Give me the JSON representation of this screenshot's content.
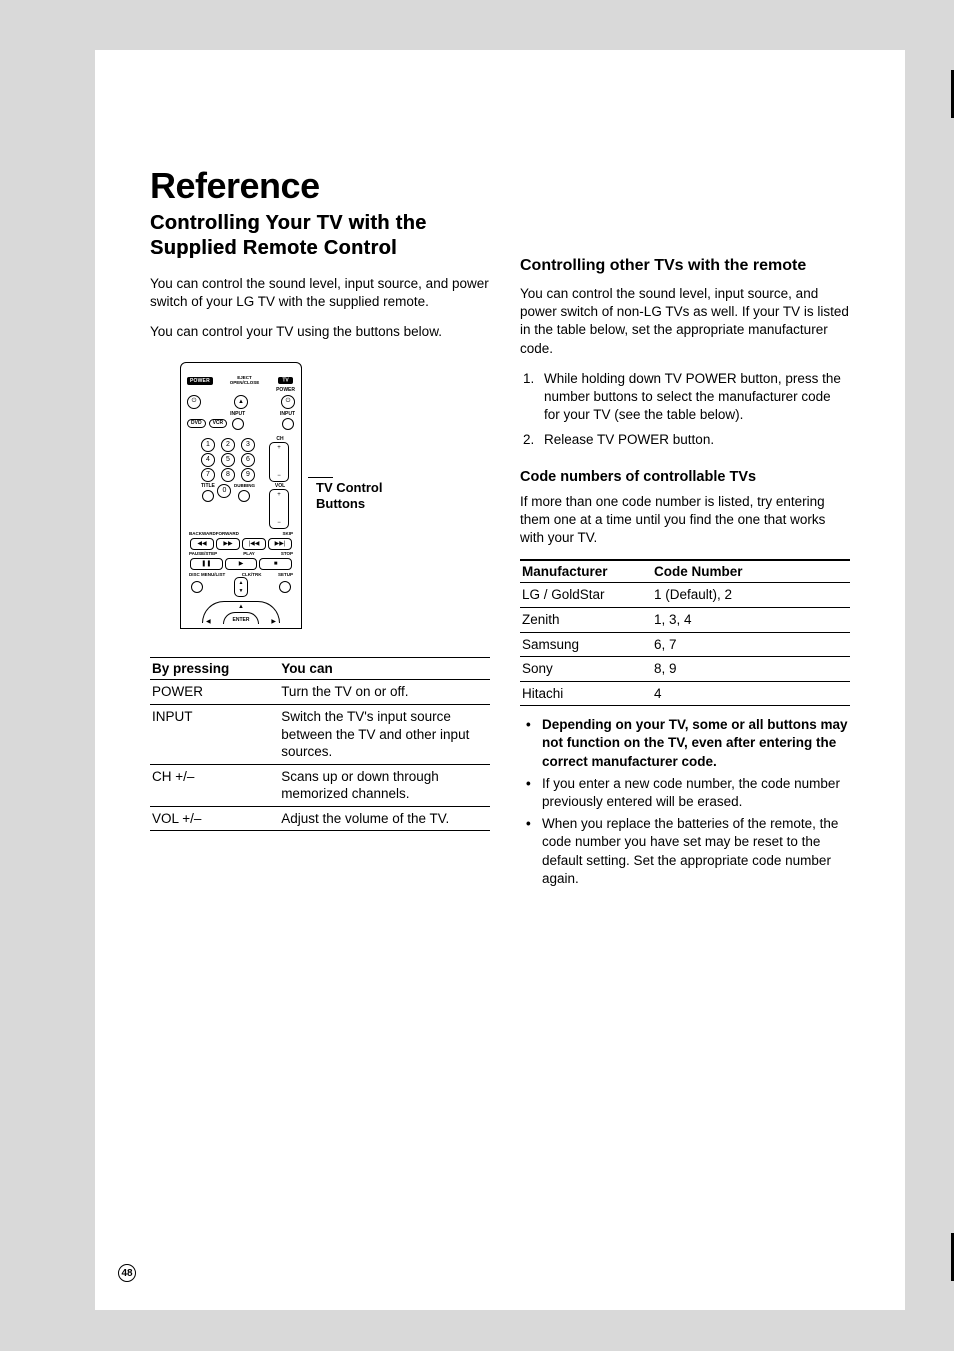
{
  "title": "Reference",
  "subtitle_l1": "Controlling Your TV with the",
  "subtitle_l2": "Supplied Remote Control",
  "left": {
    "p1": "You can control the sound level, input source, and power switch of your LG TV with the supplied remote.",
    "p2": "You can control your TV using the buttons below.",
    "tv_caption_l1": "TV Control",
    "tv_caption_l2": "Buttons"
  },
  "controls_table": {
    "h1": "By pressing",
    "h2": "You can",
    "rows": [
      {
        "a": "POWER",
        "b": "Turn the TV on or off."
      },
      {
        "a": "INPUT",
        "b": "Switch the TV's input source between the TV and other input sources."
      },
      {
        "a": "CH +/–",
        "b": "Scans up or down through memorized channels."
      },
      {
        "a": "VOL +/–",
        "b": "Adjust the volume of the TV."
      }
    ]
  },
  "right": {
    "h1": "Controlling other TVs with the remote",
    "p1": "You can control the sound level, input source, and power switch of non-LG TVs as well. If your TV is listed in the table below, set the appropriate manufacturer code.",
    "steps": [
      "While holding down TV POWER button, press the number buttons to select the manufacturer code for your TV (see the table below).",
      "Release TV POWER button."
    ],
    "h2": "Code numbers of controllable TVs",
    "p2": "If more than one code number is listed, try entering them one at a time until you find the one that works with your TV."
  },
  "codes_table": {
    "h1": "Manufacturer",
    "h2": "Code Number",
    "rows": [
      {
        "a": "LG / GoldStar",
        "b": "1 (Default), 2"
      },
      {
        "a": "Zenith",
        "b": "1, 3, 4"
      },
      {
        "a": "Samsung",
        "b": "6, 7"
      },
      {
        "a": "Sony",
        "b": "8, 9"
      },
      {
        "a": "Hitachi",
        "b": "4"
      }
    ]
  },
  "notes": [
    {
      "text": "Depending on your TV, some or all buttons may not function on the TV, even after entering the correct manufacturer code.",
      "bold": true
    },
    {
      "text": "If you enter a new code number, the code number previously entered will be erased.",
      "bold": false
    },
    {
      "text": "When you replace the batteries of the remote, the code number you have set may be reset to the default setting. Set the appropriate code number again.",
      "bold": false
    }
  ],
  "remote": {
    "power": "POWER",
    "open_close": "OPEN/CLOSE",
    "eject_l1": "EJECT",
    "tv": "TV",
    "tv_power": "POWER",
    "dvd": "DVD",
    "vcr": "VCR",
    "input1": "INPUT",
    "input2": "INPUT",
    "ch": "CH",
    "vol": "VOL",
    "title": "TITLE",
    "dubbing": "DUBBING",
    "backward": "BACKWARD",
    "forward": "FORWARD",
    "skip": "SKIP",
    "pause_step": "PAUSE/STEP",
    "play": "PLAY",
    "stop": "STOP",
    "disc_menu": "DISC MENU/LIST",
    "clk_trk": "CLK/TRK",
    "setup": "SETUP",
    "enter": "ENTER"
  },
  "page_number": "48"
}
